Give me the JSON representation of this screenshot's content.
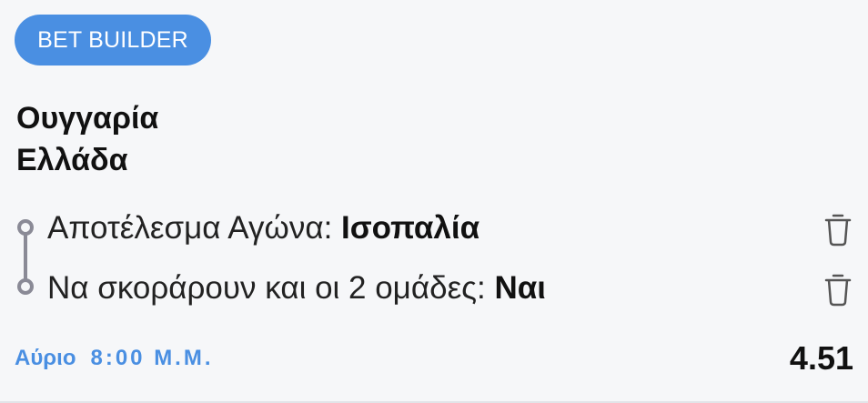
{
  "badge": {
    "label": "BET BUILDER"
  },
  "match": {
    "home_team": "Ουγγαρία",
    "away_team": "Ελλάδα"
  },
  "selections": [
    {
      "market": "Αποτέλεσμα Αγώνα: ",
      "value": "Ισοπαλία",
      "remove_icon": "trash-icon"
    },
    {
      "market": "Να σκοράρουν και οι 2 ομάδες: ",
      "value": "Ναι",
      "remove_icon": "trash-icon"
    }
  ],
  "footer": {
    "day": "Αύριο",
    "time": "8:00 Μ.Μ.",
    "odds": "4.51"
  },
  "colors": {
    "accent": "#4a8fe2",
    "background": "#f6f7f9",
    "text": "#111111",
    "connector": "#8a8a96"
  }
}
